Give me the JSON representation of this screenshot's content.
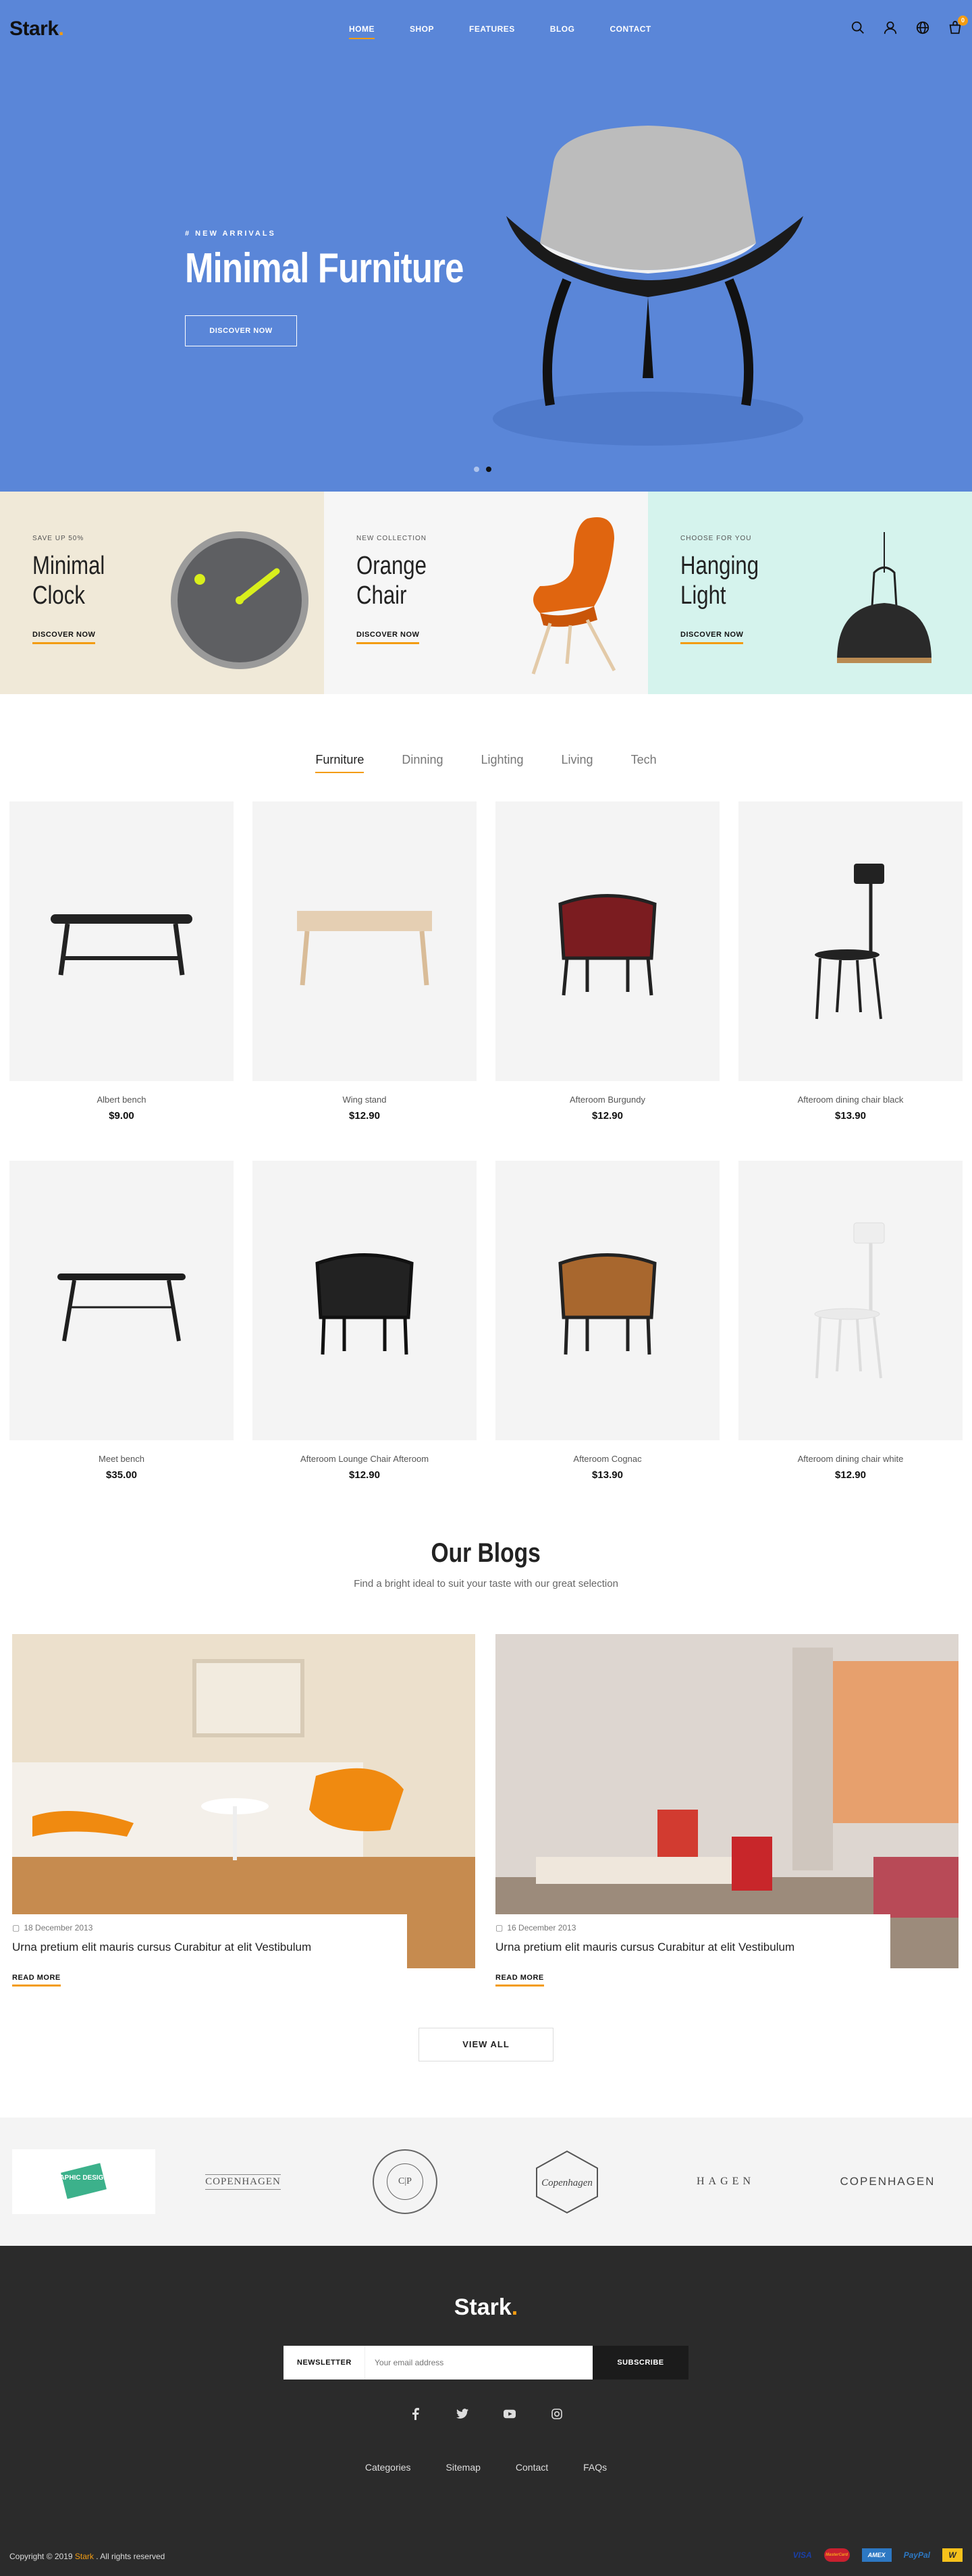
{
  "header": {
    "logo": "Stark",
    "logo_dot": ".",
    "nav": [
      "HOME",
      "SHOP",
      "FEATURES",
      "BLOG",
      "CONTACT"
    ],
    "cart_count": "0"
  },
  "hero": {
    "subtitle": "# NEW ARRIVALS",
    "title": "Minimal Furniture",
    "button": "DISCOVER NOW",
    "slide_count": 2,
    "active_slide": 2
  },
  "promos": [
    {
      "sub": "SAVE UP 50%",
      "title": "Minimal Clock",
      "link": "DISCOVER NOW",
      "bg": "#f0e9d8"
    },
    {
      "sub": "NEW COLLECTION",
      "title": "Orange Chair",
      "link": "DISCOVER NOW",
      "bg": "#f6f6f6"
    },
    {
      "sub": "CHOOSE FOR YOU",
      "title": "Hanging Light",
      "link": "DISCOVER NOW",
      "bg": "#d5f3ed"
    }
  ],
  "tabs": [
    "Furniture",
    "Dinning",
    "Lighting",
    "Living",
    "Tech"
  ],
  "products": [
    {
      "name": "Albert bench",
      "price": "$9.00"
    },
    {
      "name": "Wing stand",
      "price": "$12.90"
    },
    {
      "name": "Afteroom Burgundy",
      "price": "$12.90"
    },
    {
      "name": "Afteroom dining chair black",
      "price": "$13.90"
    },
    {
      "name": "Meet bench",
      "price": "$35.00"
    },
    {
      "name": "Afteroom Lounge Chair Afteroom",
      "price": "$12.90"
    },
    {
      "name": "Afteroom Cognac",
      "price": "$13.90"
    },
    {
      "name": "Afteroom dining chair white",
      "price": "$12.90"
    }
  ],
  "blogs": {
    "title": "Our Blogs",
    "subtitle": "Find a bright ideal to suit your taste with our great selection",
    "posts": [
      {
        "date": "18 December 2013",
        "title": "Urna pretium elit mauris cursus Curabitur at elit Vestibulum",
        "read": "READ MORE"
      },
      {
        "date": "16 December 2013",
        "title": "Urna pretium elit mauris cursus Curabitur at elit Vestibulum",
        "read": "READ MORE"
      }
    ],
    "view_all": "VIEW ALL"
  },
  "brands": [
    "GRAPHIC DESIGNER",
    "COPENHAGEN",
    "C|P",
    "Copenhagen",
    "HAGEN",
    "COPENHAGEN"
  ],
  "footer": {
    "logo": "Stark",
    "logo_dot": ".",
    "newsletter_label": "NEWSLETTER",
    "newsletter_placeholder": "Your email address",
    "subscribe": "SUBSCRIBE",
    "links": [
      "Categories",
      "Sitemap",
      "Contact",
      "FAQs"
    ],
    "copyright_pre": "Copyright © 2019",
    "copyright_brand": "Stark",
    "copyright_post": ". All rights reserved",
    "payments": [
      "VISA",
      "MasterCard",
      "AMEX",
      "PayPal",
      "W"
    ]
  },
  "colors": {
    "accent": "#f39c12",
    "hero_bg": "#5a86d8",
    "footer_bg": "#2b2b2b"
  }
}
